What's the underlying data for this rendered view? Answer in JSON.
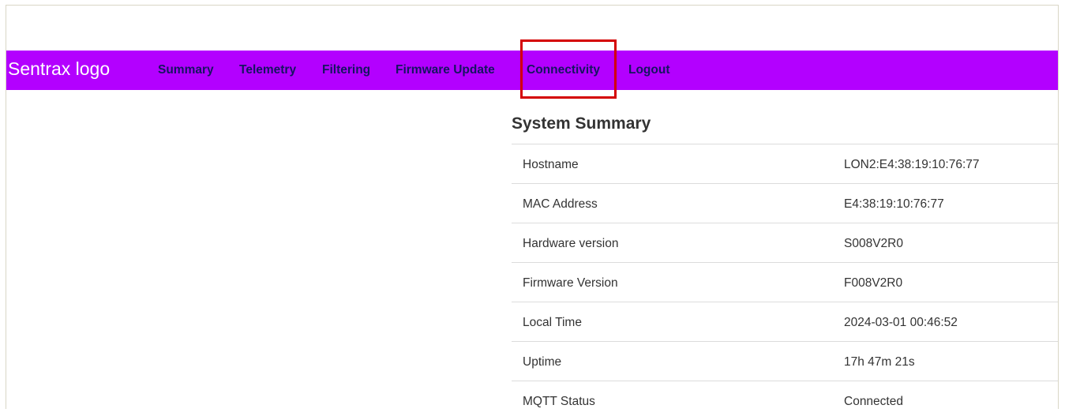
{
  "brand": {
    "logo_text": "Sentrax logo"
  },
  "nav": {
    "items": [
      {
        "label": "Summary"
      },
      {
        "label": "Telemetry"
      },
      {
        "label": "Filtering"
      },
      {
        "label": "Firmware Update"
      },
      {
        "label": "Connectivity"
      },
      {
        "label": "Logout"
      }
    ]
  },
  "summary": {
    "title": "System Summary",
    "rows": [
      {
        "label": "Hostname",
        "value": "LON2:E4:38:19:10:76:77"
      },
      {
        "label": "MAC Address",
        "value": "E4:38:19:10:76:77"
      },
      {
        "label": "Hardware version",
        "value": "S008V2R0"
      },
      {
        "label": "Firmware Version",
        "value": "F008V2R0"
      },
      {
        "label": "Local Time",
        "value": "2024-03-01 00:46:52"
      },
      {
        "label": "Uptime",
        "value": "17h 47m 21s"
      },
      {
        "label": "MQTT Status",
        "value": "Connected"
      }
    ]
  },
  "colors": {
    "navbar_bg": "#b300ff",
    "nav_link": "#151560",
    "highlight_border": "#d40000"
  }
}
